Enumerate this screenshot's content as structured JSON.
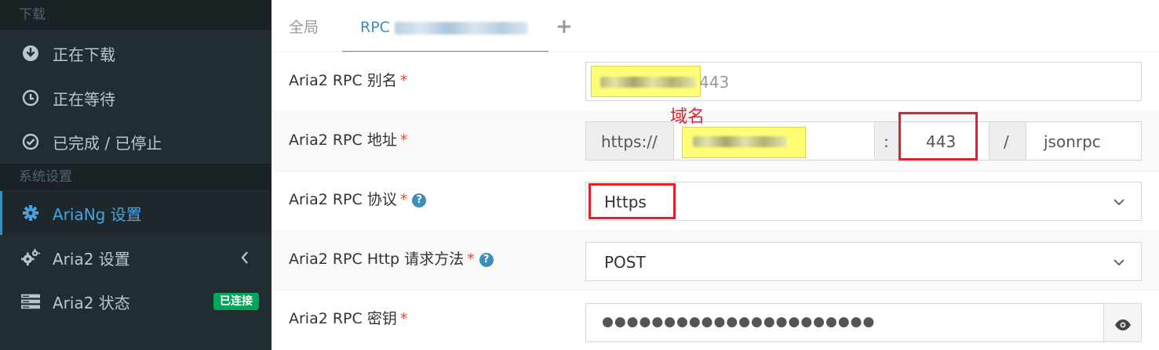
{
  "sidebar": {
    "section_download": "下载",
    "items_download": [
      {
        "label": "正在下载",
        "icon": "download-circle-icon"
      },
      {
        "label": "正在等待",
        "icon": "clock-icon"
      },
      {
        "label": "已完成 / 已停止",
        "icon": "check-circle-icon"
      }
    ],
    "section_settings": "系统设置",
    "items_settings": [
      {
        "label": "AriaNg 设置",
        "icon": "gear-icon"
      },
      {
        "label": "Aria2 设置",
        "icon": "gears-icon"
      },
      {
        "label": "Aria2 状态",
        "icon": "server-icon"
      }
    ],
    "status_badge": "已连接",
    "colors": {
      "bg": "#222d32",
      "header": "#1a2226",
      "active_accent": "#3c8dbc",
      "badge": "#00a65a"
    }
  },
  "tabs": {
    "global": "全局",
    "rpc": "RPC",
    "add": "+"
  },
  "form": {
    "alias": {
      "label": "Aria2 RPC 别名",
      "required": "*",
      "value_suffix": "443"
    },
    "address": {
      "label": "Aria2 RPC 地址",
      "required": "*",
      "scheme": "https://",
      "colon": ":",
      "port": "443",
      "slash": "/",
      "path": "jsonrpc"
    },
    "protocol": {
      "label": "Aria2 RPC 协议",
      "required": "*",
      "help": "?",
      "value": "Https"
    },
    "method": {
      "label": "Aria2 RPC Http 请求方法",
      "required": "*",
      "help": "?",
      "value": "POST"
    },
    "secret": {
      "label": "Aria2 RPC 密钥",
      "required": "*",
      "value": "●●●●●●●●●●●●●●●●●●●●●●"
    }
  },
  "annotation": {
    "domain_label": "域名",
    "color": "#e0202a"
  }
}
